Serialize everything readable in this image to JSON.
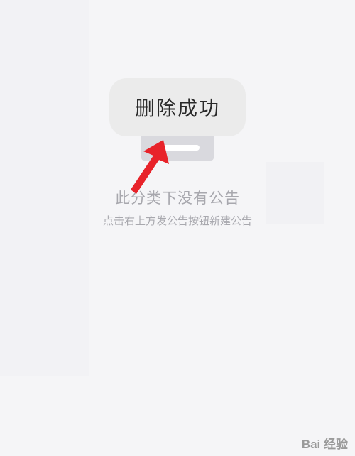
{
  "toast": {
    "message": "删除成功"
  },
  "empty_state": {
    "title": "此分类下没有公告",
    "subtitle": "点击右上方发公告按钮新建公告"
  },
  "watermark": {
    "text": "Bai 经验"
  },
  "colors": {
    "background": "#f5f5f7",
    "toast_bg": "#ebebeb",
    "text_muted": "#a8a8ae",
    "arrow": "#e8232a"
  }
}
